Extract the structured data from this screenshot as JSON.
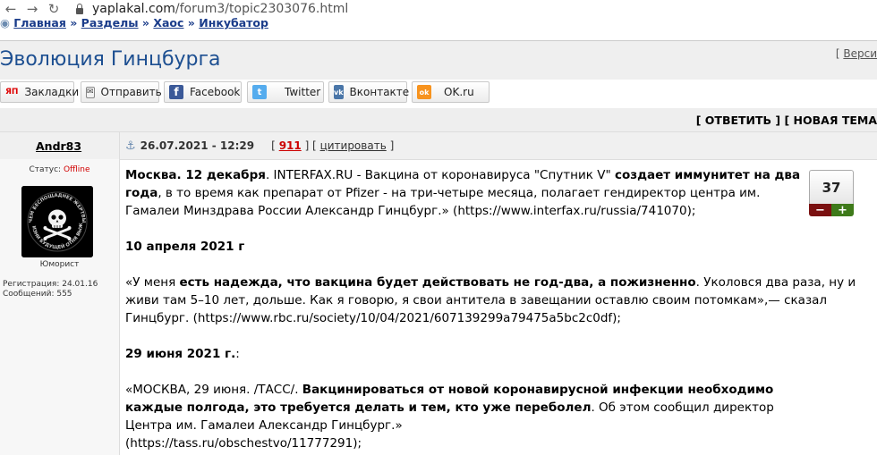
{
  "browser": {
    "url_host": "yaplakal.com",
    "url_path": "/forum3/topic2303076.html"
  },
  "breadcrumb": {
    "items": [
      "Главная",
      "Разделы",
      "Хаос",
      "Инкубатор"
    ],
    "sep": "»"
  },
  "topic": {
    "title": "Эволюция Гинцбурга",
    "version_link": "Верси",
    "version_open": "[ "
  },
  "share": [
    {
      "label": "Закладки",
      "icon": "yandex-bookmarks-icon",
      "color": "#ffffff",
      "text_icon": "ЯП"
    },
    {
      "label": "Отправить",
      "icon": "mail-icon",
      "color": "#ffffff",
      "text_icon": "✉"
    },
    {
      "label": "Facebook",
      "icon": "facebook-icon",
      "color": "#3b5998",
      "text_icon": "f"
    },
    {
      "label": "Twitter",
      "icon": "twitter-icon",
      "color": "#55acee",
      "text_icon": "t"
    },
    {
      "label": "Вконтакте",
      "icon": "vk-icon",
      "color": "#4a76a8",
      "text_icon": "vk"
    },
    {
      "label": "OK.ru",
      "icon": "odnoklassniki-icon",
      "color": "#f7931e",
      "text_icon": "ok"
    }
  ],
  "actions": {
    "reply": "ОТВЕТИТЬ",
    "new_topic": "НОВАЯ ТЕМА"
  },
  "post": {
    "author": "Andr83",
    "date": "26.07.2021 - 12:29",
    "number": "911",
    "quote": "цитировать",
    "score": "37",
    "minus": "−",
    "plus": "+"
  },
  "user": {
    "status_label": "Статус:",
    "status_value": "Offline",
    "rank": "Юморист",
    "registration": "Регистрация: 24.01.16",
    "messages": "Сообщений: 555",
    "avatar_text_top": "ЧЕМ БЕСПОЩАДНЕЕ ЖЕРТВЫ",
    "avatar_text_bottom": "В ЖИЗНИ БУДУЩЕЙ ОТНЯ ВЫЖИЛ"
  },
  "body": {
    "p1": {
      "b1": "Москва. 12 декабря",
      "t1": ". INTERFAX.RU - Вакцина от коронавируса \"Спутник V\" ",
      "b2": "создает иммунитет на два года",
      "t2": ", в то время как препарат от Pfizer - на три-четыре месяца, полагает гендиректор центра им. Гамалеи Минздрава России Александр Гинцбург.» (https://www.interfax.ru/russia/741070);"
    },
    "h2": "10 апреля 2021 г",
    "p2": {
      "t1": "«У меня ",
      "b1": "есть надежда, что вакцина будет действовать не год-два, а пожизненно",
      "t2": ". Уколовся два раза, ну и живи там 5–10 лет, дольше. Как я говорю, я свои антитела в завещании оставлю своим потомкам»,— сказал Гинцбург. (https://www.rbc.ru/society/10/04/2021/607139299a79475a5bc2c0df);"
    },
    "h3": "29 июня 2021 г.",
    "h3_tail": ":",
    "p3": {
      "t1": "«МОСКВА, 29 июня. /ТАСС/. ",
      "b1": "Вакцинироваться от новой коронавирусной инфекции необходимо каждые полгода, это требуется делать и тем, кто уже переболел",
      "t2": ". Об этом сообщил директор Центра им. Гамалеи Александр Гинцбург.»"
    },
    "p3_link": "(https://tass.ru/obschestvo/11777291);"
  }
}
